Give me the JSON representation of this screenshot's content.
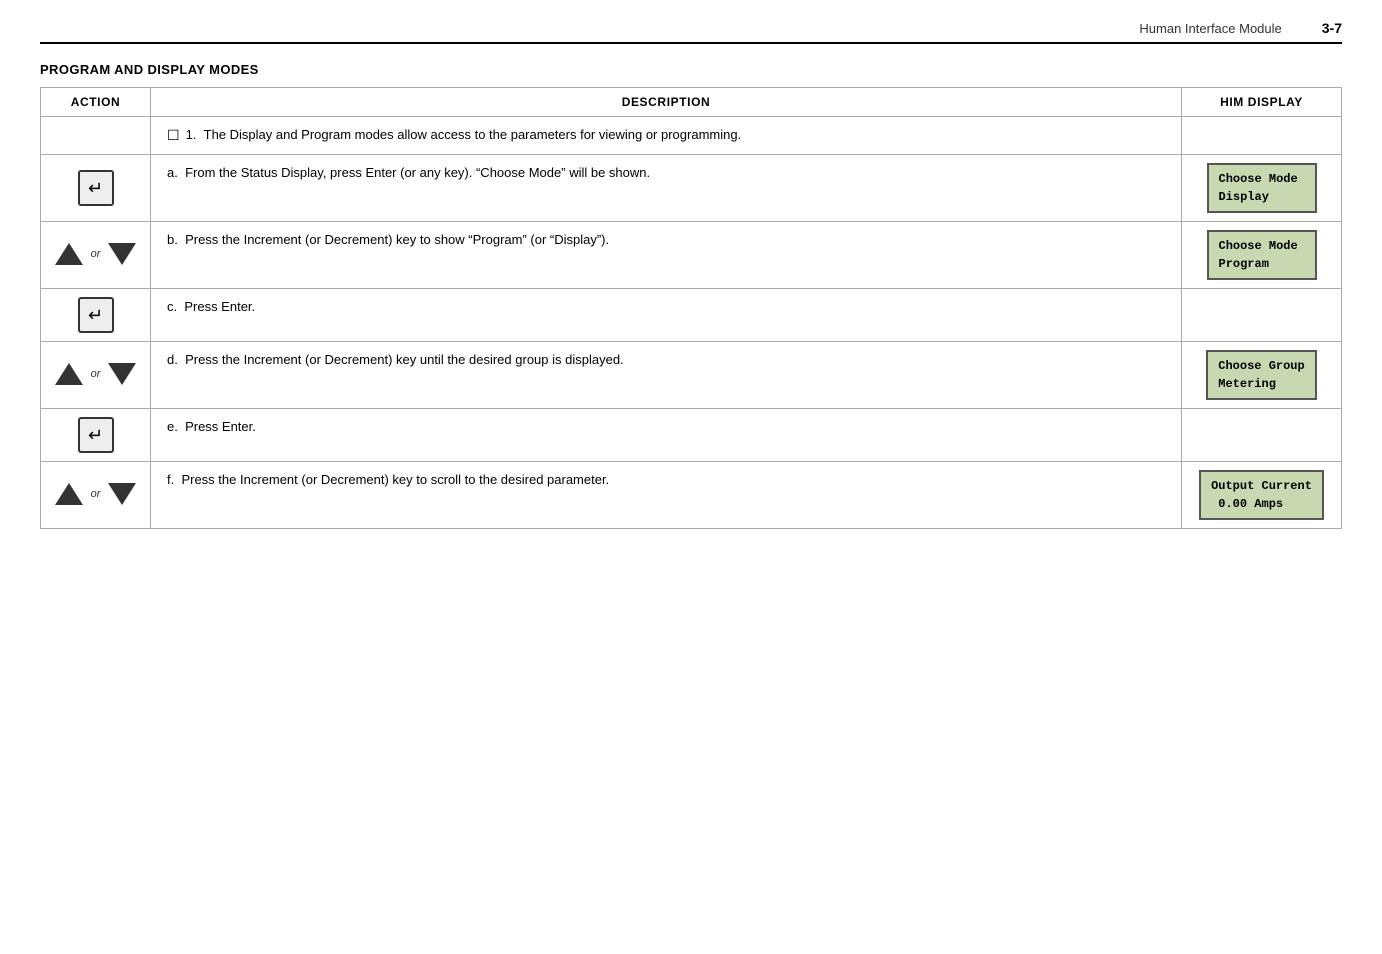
{
  "header": {
    "title": "Human Interface Module",
    "page_number": "3-7"
  },
  "section": {
    "title": "PROGRAM AND DISPLAY MODES"
  },
  "table": {
    "columns": [
      "ACTION",
      "DESCRIPTION",
      "HIM DISPLAY"
    ],
    "rows": [
      {
        "action": "none",
        "description_type": "numbered",
        "number": "1.",
        "description": "The Display and Program modes allow access to the parameters for viewing or programming.",
        "him_display": null
      },
      {
        "action": "enter",
        "description_type": "lettered",
        "letter": "a.",
        "description": "From the Status Display, press Enter (or any key). “Choose Mode” will be shown.",
        "him_display": "Choose Mode\nDisplay"
      },
      {
        "action": "arrows",
        "description_type": "lettered",
        "letter": "b.",
        "description": "Press the Increment (or Decrement) key to show “Program” (or “Display”).",
        "him_display": "Choose Mode\nProgram"
      },
      {
        "action": "enter",
        "description_type": "lettered",
        "letter": "c.",
        "description": "Press Enter.",
        "him_display": null
      },
      {
        "action": "arrows",
        "description_type": "lettered",
        "letter": "d.",
        "description": "Press the Increment (or Decrement) key until the desired group is displayed.",
        "him_display": "Choose Group\nMetering"
      },
      {
        "action": "enter",
        "description_type": "lettered",
        "letter": "e.",
        "description": "Press Enter.",
        "him_display": null
      },
      {
        "action": "arrows",
        "description_type": "lettered",
        "letter": "f.",
        "description": "Press the Increment (or Decrement) key to scroll to the desired parameter.",
        "him_display": "Output Current\n 0.00 Amps"
      }
    ]
  }
}
